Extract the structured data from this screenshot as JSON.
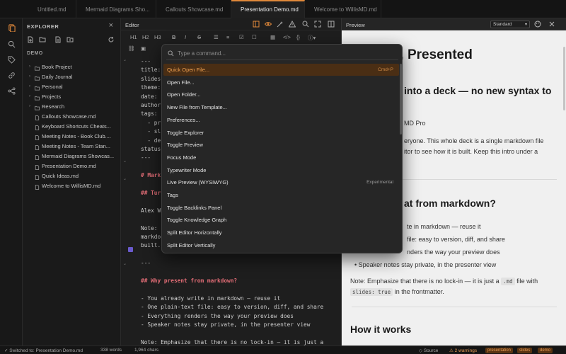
{
  "tabs": [
    {
      "label": "Untitled.md"
    },
    {
      "label": "Mermaid Diagrams Sho..."
    },
    {
      "label": "Callouts Showcase.md"
    },
    {
      "label": "Presentation Demo.md",
      "active": true
    },
    {
      "label": "Welcome to WillisMD.md"
    }
  ],
  "activity": [
    "files-icon",
    "search-icon",
    "tag-icon",
    "link-icon",
    "graph-icon"
  ],
  "explorer": {
    "title": "EXPLORER",
    "section": "DEMO",
    "folders": [
      "Book Project",
      "Daily Journal",
      "Personal",
      "Projects",
      "Research"
    ],
    "files": [
      "Callouts Showcase.md",
      "Keyboard Shortcuts Cheats...",
      "Meeting Notes - Book Club....",
      "Meeting Notes - Team Stan...",
      "Mermaid Diagrams Showcas...",
      "Presentation Demo.md",
      "Quick Ideas.md",
      "Welcome to WillisMD.md"
    ]
  },
  "editor": {
    "title": "Editor",
    "toolbar1": [
      "H1",
      "H2",
      "H3",
      "B",
      "I",
      "S"
    ],
    "code_lines": [
      "---",
      "title: ",
      "slides",
      "theme:",
      "date: ",
      "author",
      "tags: ",
      "  - pr",
      "  - sl",
      "  - de",
      "status",
      "---",
      "",
      "# Mark",
      "",
      "## Tur",
      "",
      "Alex W",
      "",
      "Note: ",
      "markdo",
      "built.",
      "",
      "---",
      "",
      "## Why present from markdown?",
      "",
      "- You already write in markdown — reuse it",
      "- One plain-text file: easy to version, diff, and share",
      "- Everything renders the way your preview does",
      "- Speaker notes stay private, in the presenter view",
      "",
      "Note: Emphasize that there is no lock-in — it is just a"
    ]
  },
  "preview": {
    "title": "Preview",
    "mode": "Standard",
    "h1": "wn, Presented",
    "h2_intro": "into a deck — no new syntax to",
    "author_frag": "MD Pro",
    "intro_1": "eryone. This whole deck is a single markdown file",
    "intro_2": "itor to see how it is built. Keep this intro under a",
    "h2_why": "at from markdown?",
    "bullets": [
      "te in markdown — reuse it",
      "file: easy to version, diff, and share",
      "nders the way your preview does",
      "Speaker notes stay private, in the presenter view"
    ],
    "note_prefix": "Note: Emphasize that there is no lock-in — it is just a",
    "note_code1": ".md",
    "note_mid": "file with",
    "note_code2": "slides: true",
    "note_suffix": "in the frontmatter.",
    "h2_how": "How it works"
  },
  "palette": {
    "placeholder": "Type a command...",
    "items": [
      {
        "label": "Quick Open File...",
        "hint": "Cmd+P",
        "selected": true
      },
      {
        "label": "Open File..."
      },
      {
        "label": "Open Folder..."
      },
      {
        "label": "New File from Template..."
      },
      {
        "label": "Preferences..."
      },
      {
        "label": "Toggle Explorer"
      },
      {
        "label": "Toggle Preview"
      },
      {
        "label": "Focus Mode"
      },
      {
        "label": "Typewriter Mode"
      },
      {
        "label": "Live Preview (WYSIWYG)",
        "hint": "Experimental"
      },
      {
        "label": "Tags"
      },
      {
        "label": "Toggle Backlinks Panel"
      },
      {
        "label": "Toggle Knowledge Graph"
      },
      {
        "label": "Split Editor Horizontally"
      },
      {
        "label": "Split Editor Vertically"
      }
    ]
  },
  "status": {
    "switched": "✓ Switched to: Presentation Demo.md",
    "words": "338 words",
    "chars": "1,964 chars",
    "source": "Source",
    "warnings": "2 warnings",
    "badges": [
      "presentation",
      "slides",
      "demo"
    ]
  },
  "colors": {
    "accent": "#e0883a",
    "selected_bg": "#4a2e14",
    "heading_red": "#e06c75"
  }
}
